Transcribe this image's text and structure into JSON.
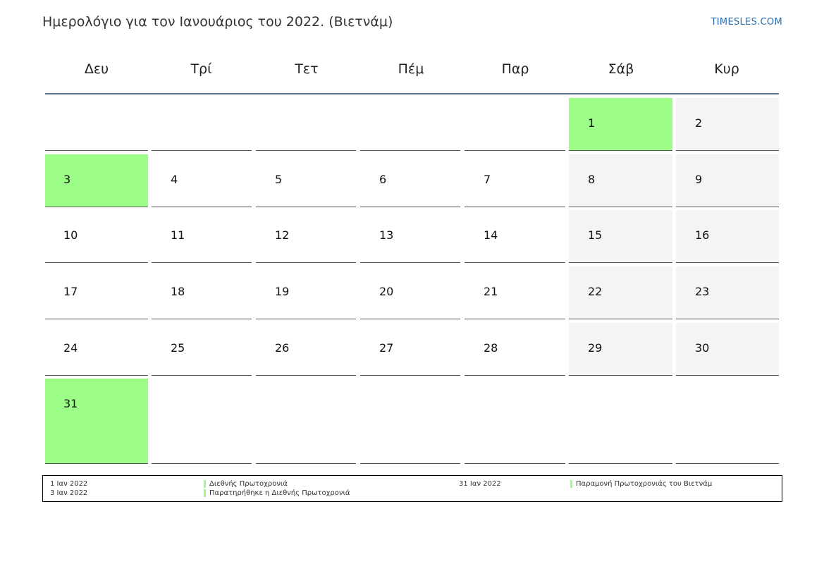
{
  "header": {
    "title": "Ημερολόγιο για τον Ιανουάριος του 2022. (Βιετνάμ)",
    "brand": "TIMESLES.COM"
  },
  "weekdays": [
    "Δευ",
    "Τρί",
    "Τετ",
    "Πέμ",
    "Παρ",
    "Σάβ",
    "Κυρ"
  ],
  "calendar": {
    "days_in_month": 31,
    "first_weekday_index": 5,
    "holidays": [
      1,
      3,
      31
    ],
    "weekend_columns": [
      5,
      6
    ]
  },
  "legend": [
    {
      "date": "1 Ιαν 2022",
      "name": "Διεθνής Πρωτοχρονιά"
    },
    {
      "date": "3 Ιαν 2022",
      "name": "Παρατηρήθηκε η Διεθνής Πρωτοχρονιά"
    },
    {
      "date": "31 Ιαν 2022",
      "name": "Παραμονή Πρωτοχρονιάς του Βιετνάμ"
    }
  ],
  "colors": {
    "holiday": "#9cfe86",
    "weekend": "#f4f4f4",
    "header_rule": "#5a7290",
    "brand": "#2a6fb0"
  }
}
